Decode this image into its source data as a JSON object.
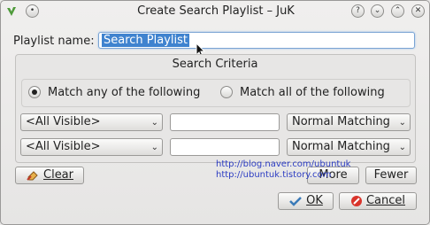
{
  "window": {
    "title": "Create Search Playlist – JuK",
    "buttons": {
      "help": "?",
      "minimize": "⌄",
      "maximize": "⌃",
      "close": "✕"
    }
  },
  "playlist_name": {
    "label": "Playlist name:",
    "value": "Search Playlist"
  },
  "criteria": {
    "title": "Search Criteria",
    "match_any_label": "Match any of the following",
    "match_all_label": "Match all of the following",
    "selected": "any",
    "rows": [
      {
        "field": "<All Visible>",
        "text": "",
        "mode": "Normal Matching"
      },
      {
        "field": "<All Visible>",
        "text": "",
        "mode": "Normal Matching"
      }
    ]
  },
  "actions": {
    "clear_label": "Clear",
    "more_label": "More",
    "fewer_label": "Fewer",
    "ok_label": "OK",
    "cancel_label": "Cancel"
  },
  "watermark": {
    "line1": "http://blog.naver.com/ubuntuk",
    "line2": "http://ubuntuk.tistory.com"
  },
  "colors": {
    "selection": "#3f83cf",
    "watermark": "#2b3cc2"
  }
}
